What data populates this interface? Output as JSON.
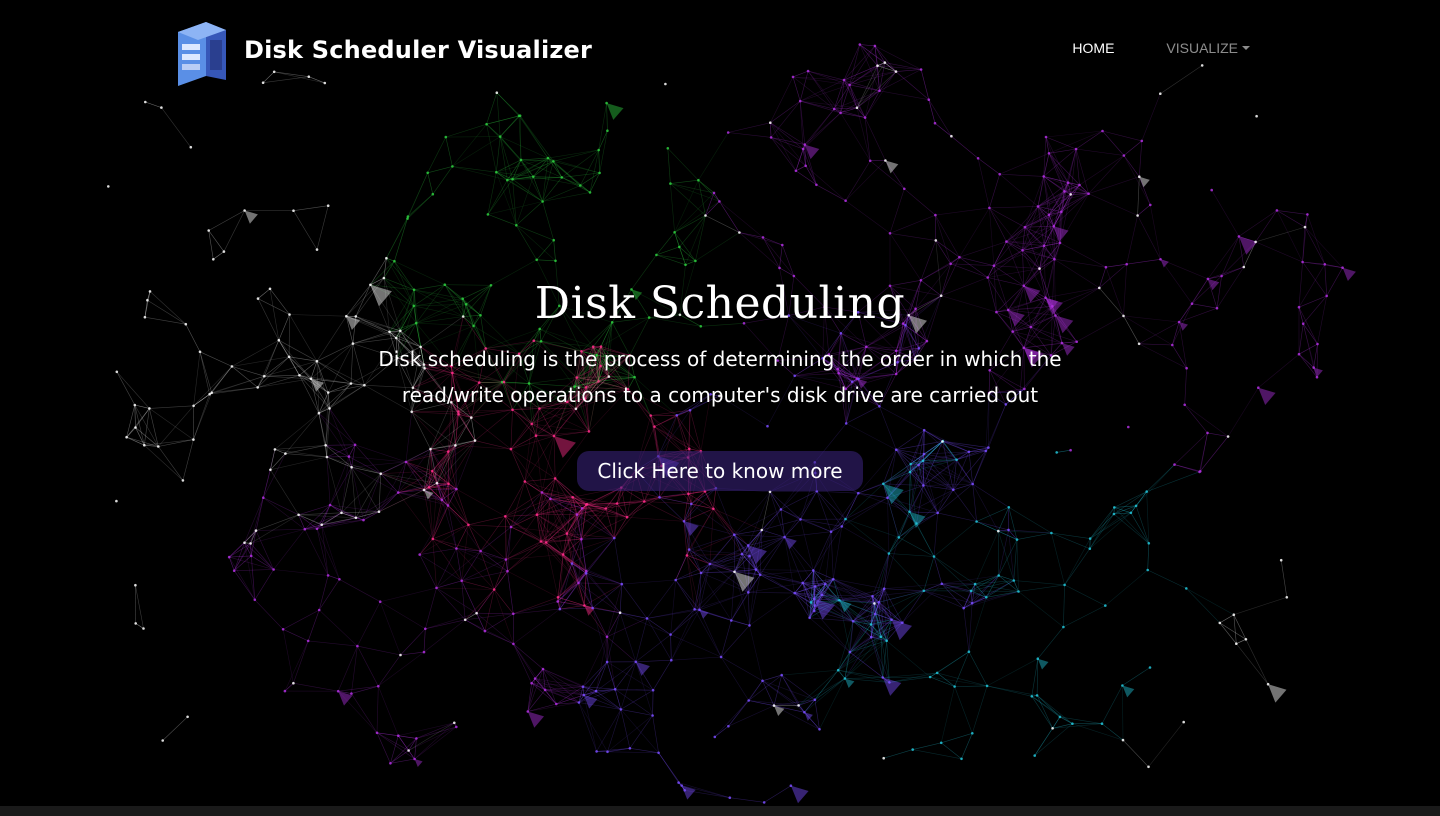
{
  "brand": {
    "name": "Disk Scheduler Visualizer",
    "logo_icon": "disk-server-icon"
  },
  "nav": {
    "home_label": "HOME",
    "visualize_label": "VISUALIZE"
  },
  "hero": {
    "title": "Disk Scheduling",
    "description": "Disk scheduling is the process of determining the order in which the read/write operations to a computer's disk drive are carried out",
    "cta_label": "Click Here to know more"
  },
  "colors": {
    "background": "#000000",
    "text": "#ffffff",
    "cta_bg": "rgba(60,36,130,0.55)",
    "network_palette": [
      "#2ecc40",
      "#b030e0",
      "#ff2d8a",
      "#7a4dff",
      "#22c4d8",
      "#ffffff"
    ]
  }
}
